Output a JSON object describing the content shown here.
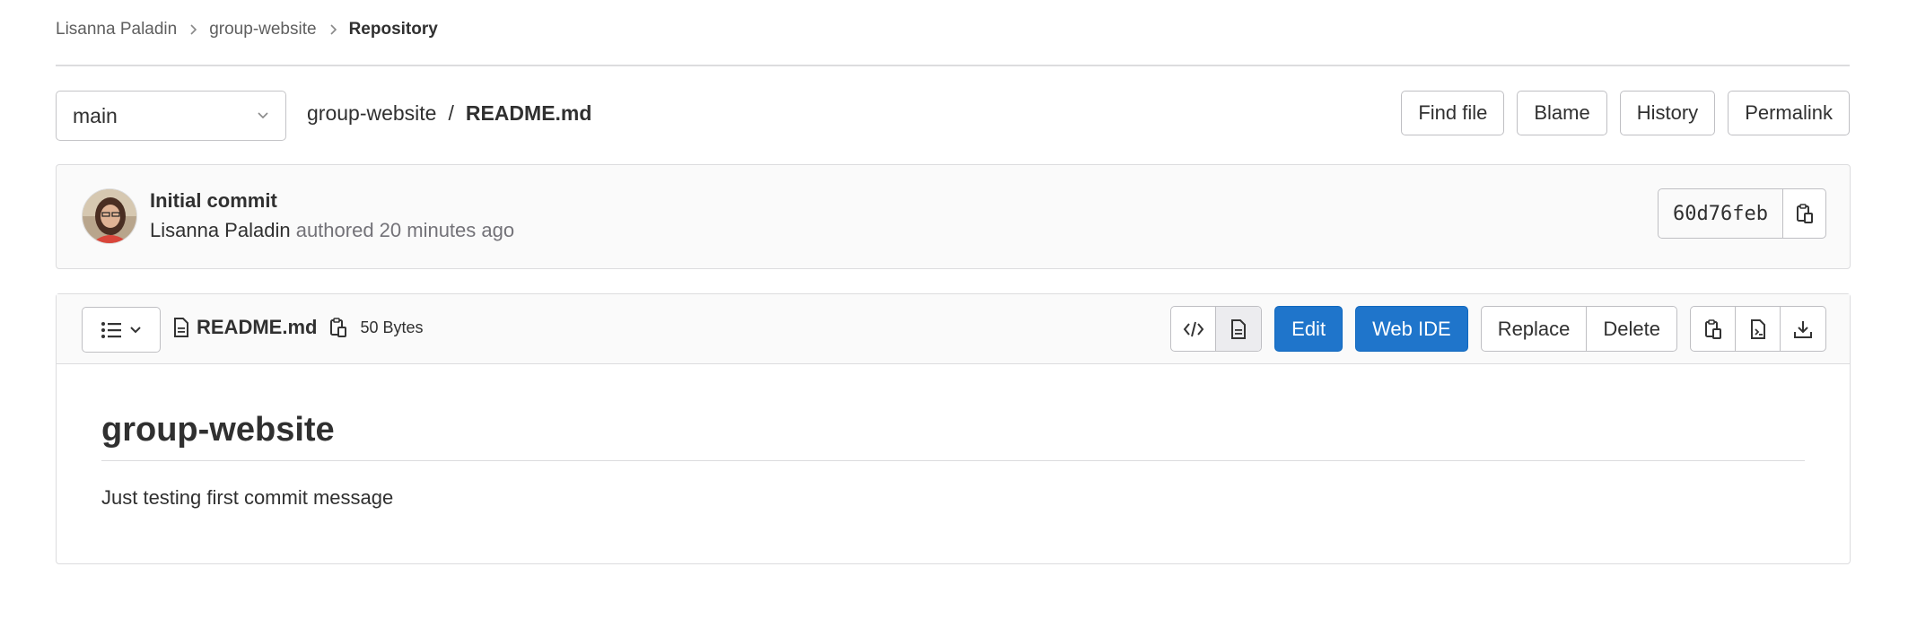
{
  "breadcrumb": {
    "items": [
      "Lisanna Paladin",
      "group-website"
    ],
    "current": "Repository"
  },
  "nav": {
    "branch": "main",
    "project": "group-website",
    "separator": "/",
    "file_name": "README.md",
    "actions": {
      "find_file": "Find file",
      "blame": "Blame",
      "history": "History",
      "permalink": "Permalink"
    }
  },
  "commit": {
    "title": "Initial commit",
    "author": "Lisanna Paladin",
    "meta": "authored 20 minutes ago",
    "sha": "60d76feb"
  },
  "file": {
    "name": "README.md",
    "size": "50 Bytes",
    "actions": {
      "edit": "Edit",
      "web_ide": "Web IDE",
      "replace": "Replace",
      "delete": "Delete"
    }
  },
  "readme": {
    "heading": "group-website",
    "paragraph": "Just testing first commit message"
  },
  "colors": {
    "primary": "#1f75cb",
    "border": "#dcdcde",
    "header_bg": "#fafafa"
  },
  "icons": [
    "chevron-right-icon",
    "chevron-down-icon",
    "copy-icon",
    "list-icon",
    "document-icon",
    "code-icon",
    "file-code-icon",
    "download-icon"
  ]
}
